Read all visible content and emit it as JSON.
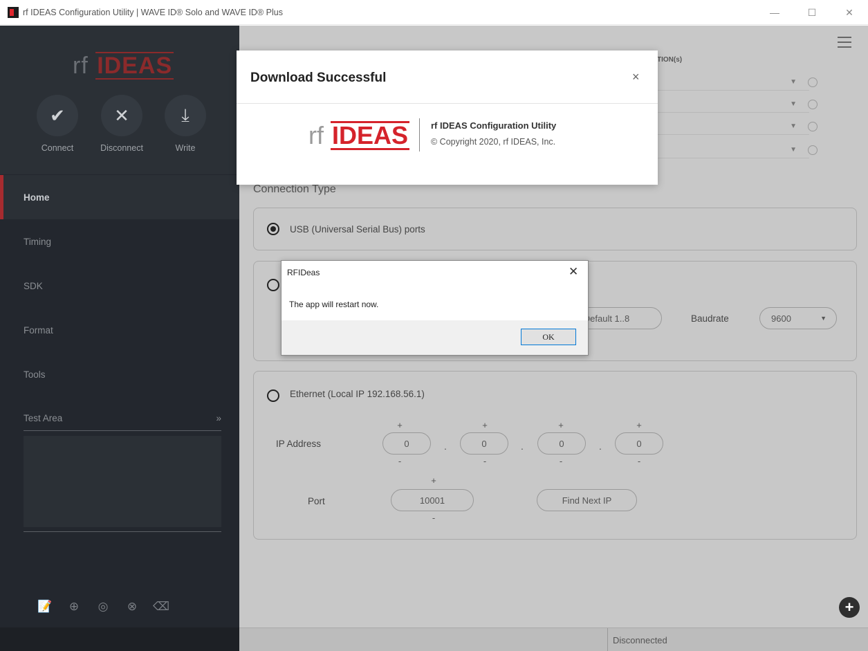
{
  "window": {
    "title": "rf IDEAS Configuration Utility | WAVE ID® Solo and WAVE ID® Plus",
    "controls": {
      "minimize": "—",
      "maximize": "☐",
      "close": "✕"
    }
  },
  "sidebar": {
    "logo": {
      "prefix": "rf",
      "brand": "IDEAS"
    },
    "actions": [
      {
        "label": "Connect",
        "icon": "✔"
      },
      {
        "label": "Disconnect",
        "icon": "✕"
      },
      {
        "label": "Write",
        "icon": "⤓"
      }
    ],
    "nav": [
      "Home",
      "Timing",
      "SDK",
      "Format",
      "Tools"
    ],
    "active_nav": "Home",
    "test_area": {
      "label": "Test Area",
      "expand": "»"
    },
    "tool_icons": [
      "📝",
      "⊕",
      "◎",
      "⊗",
      "⌫"
    ]
  },
  "main": {
    "top_panel_title": "TION(s)",
    "connection_type_label": "Connection Type",
    "usb": {
      "label": "USB (Universal Serial Bus) ports",
      "selected": true
    },
    "serial": {
      "stopbits_value": "Default 1..8",
      "baudrate_label": "Baudrate",
      "baudrate_value": "9600"
    },
    "ethernet": {
      "label": "Ethernet (Local IP 192.168.56.1)",
      "ip_label": "IP Address",
      "ip_octets": [
        "0",
        "0",
        "0",
        "0"
      ],
      "port_label": "Port",
      "port_value": "10001",
      "find_button": "Find Next IP",
      "plus": "+",
      "minus": "-"
    },
    "status": "Disconnected"
  },
  "download_dialog": {
    "title": "Download Successful",
    "close": "×",
    "logo": {
      "prefix": "rf",
      "brand": "IDEAS"
    },
    "app_name": "rf IDEAS Configuration Utility",
    "copyright": "© Copyright 2020, rf IDEAS, Inc."
  },
  "message_box": {
    "title": "RFIDeas",
    "close": "✕",
    "text": "The app will restart now.",
    "ok": "OK"
  }
}
